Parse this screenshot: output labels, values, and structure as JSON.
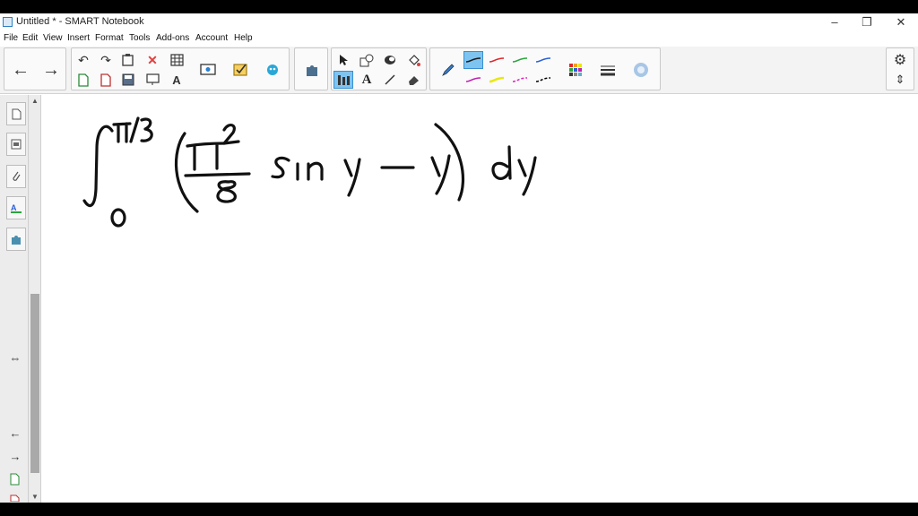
{
  "window": {
    "title": "Untitled * - SMART Notebook",
    "minimize_glyph": "–",
    "restore_glyph": "❐",
    "close_glyph": "✕"
  },
  "menu": [
    "File",
    "Edit",
    "View",
    "Insert",
    "Format",
    "Tools",
    "Add-ons",
    "Account",
    "Help"
  ],
  "toolbar": {
    "back_icon": "←",
    "forward_icon": "→",
    "undo_icon": "↶",
    "redo_icon": "↷",
    "delete_icon": "✕",
    "text_icon": "A",
    "pen_colors": [
      "#1a1a1a",
      "#e0262b",
      "#2aa53c",
      "#2a5fd6",
      "#c020b0",
      "#e8e810",
      "#e020c0",
      "#000000"
    ],
    "accent": "#7ec4f0"
  },
  "sidebar": {
    "icons": [
      "page-sorter",
      "gallery",
      "attachments",
      "properties",
      "add-ons"
    ],
    "resize_glyph": "⇔",
    "prev_glyph": "←",
    "next_glyph": "→"
  },
  "canvas": {
    "handwriting": "∫ from 0 to π/3 of (π²/8 sin y − y) dy"
  }
}
